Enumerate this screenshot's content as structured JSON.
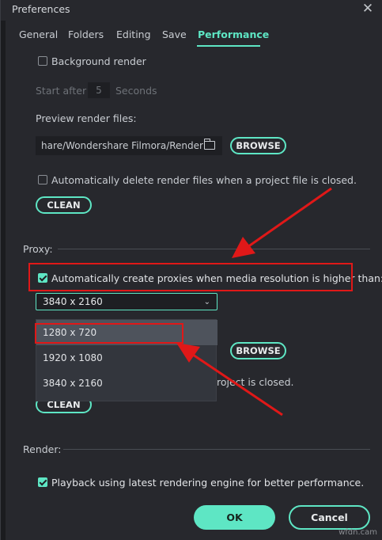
{
  "window": {
    "title": "Preferences",
    "close_glyph": "✕"
  },
  "tabs": [
    "General",
    "Folders",
    "Editing",
    "Save",
    "Performance"
  ],
  "render": {
    "background_render_label": "Background render",
    "start_after_label": "Start after",
    "start_after_value": "5",
    "seconds_label": "Seconds",
    "preview_render_files_label": "Preview render files:",
    "path_value": "hare/Wondershare Filmora/Render",
    "browse_label": "BROWSE",
    "auto_delete_label": "Automatically delete render files when a project file is closed.",
    "clean_label": "CLEAN"
  },
  "proxy": {
    "section_label": "Proxy:",
    "auto_create_label": "Automatically create proxies when media resolution is higher than:",
    "selected_resolution": "3840 x 2160",
    "options": [
      "1280 x 720",
      "1920 x 1080",
      "3840 x 2160"
    ],
    "browse_label": "BROWSE",
    "partial_text": "roject is closed.",
    "clean_label": "CLEAN"
  },
  "render_section": {
    "section_label": "Render:",
    "playback_label": "Playback using latest rendering engine for better performance."
  },
  "footer": {
    "ok_label": "OK",
    "cancel_label": "Cancel"
  },
  "watermark": "wfdn.cam",
  "colors": {
    "accent": "#5ee6c4",
    "annotation_red": "#e01818",
    "background": "#27282d"
  }
}
